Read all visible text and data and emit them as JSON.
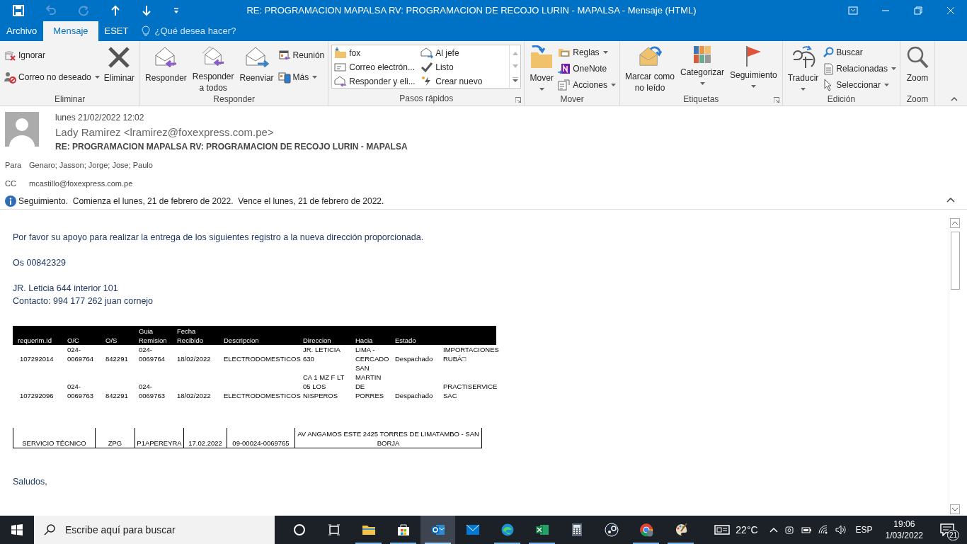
{
  "window": {
    "title": "RE: PROGRAMACION MAPALSA RV: PROGRAMACION DE RECOJO LURIN - MAPALSA - Mensaje (HTML)"
  },
  "tabs": [
    {
      "label": "Archivo",
      "selected": false
    },
    {
      "label": "Mensaje",
      "selected": true
    },
    {
      "label": "ESET",
      "selected": false
    }
  ],
  "tell_me": {
    "placeholder": "¿Qué desea hacer?"
  },
  "ribbon": {
    "groups": [
      {
        "label": "Eliminar",
        "columns": [
          {
            "kind": "stack",
            "items": [
              {
                "label": "Ignorar",
                "dropdown": false
              },
              {
                "label": "Correo no deseado",
                "dropdown": true
              }
            ]
          },
          {
            "kind": "large",
            "label": "Eliminar",
            "dropdown": false
          }
        ]
      },
      {
        "label": "Responder",
        "columns": [
          {
            "kind": "large",
            "label": "Responder",
            "dropdown": false
          },
          {
            "kind": "large",
            "label": "Responder\na todos",
            "dropdown": false
          },
          {
            "kind": "large",
            "label": "Reenviar",
            "dropdown": false
          },
          {
            "kind": "stack",
            "items": [
              {
                "label": "Reunión",
                "dropdown": false
              },
              {
                "label": "Más",
                "dropdown": true
              }
            ]
          }
        ]
      },
      {
        "label": "Pasos rápidos",
        "launcher": true,
        "columns": [
          {
            "kind": "gallery",
            "items": [
              {
                "label": "fox"
              },
              {
                "label": "Al jefe"
              },
              {
                "label": "Correo electrón..."
              },
              {
                "label": "Listo"
              },
              {
                "label": "Responder y eli..."
              },
              {
                "label": "Crear nuevo"
              }
            ]
          }
        ]
      },
      {
        "label": "Mover",
        "columns": [
          {
            "kind": "large",
            "label": "Mover",
            "dropdown": true
          },
          {
            "kind": "stack",
            "items": [
              {
                "label": "Reglas",
                "dropdown": true
              },
              {
                "label": "OneNote",
                "dropdown": false
              },
              {
                "label": "Acciones",
                "dropdown": true
              }
            ]
          }
        ]
      },
      {
        "label": "Etiquetas",
        "launcher": true,
        "columns": [
          {
            "kind": "large",
            "label": "Marcar como\nno leído",
            "dropdown": false
          },
          {
            "kind": "large",
            "label": "Categorizar",
            "dropdown": true
          },
          {
            "kind": "large",
            "label": "Seguimiento",
            "dropdown": true
          }
        ]
      },
      {
        "label": "Edición",
        "columns": [
          {
            "kind": "large",
            "label": "Traducir",
            "dropdown": true
          },
          {
            "kind": "stack",
            "items": [
              {
                "label": "Buscar",
                "dropdown": false
              },
              {
                "label": "Relacionadas",
                "dropdown": true
              },
              {
                "label": "Seleccionar",
                "dropdown": true
              }
            ]
          }
        ]
      },
      {
        "label": "Zoom",
        "columns": [
          {
            "kind": "large",
            "label": "Zoom",
            "dropdown": false
          }
        ]
      }
    ]
  },
  "message": {
    "date": "lunes 21/02/2022 12:02",
    "sender": "Lady Ramirez <lramirez@foxexpress.com.pe>",
    "subject": "RE: PROGRAMACION MAPALSA RV: PROGRAMACION DE RECOJO LURIN - MAPALSA",
    "to_label": "Para",
    "to": "Genaro; Jasson; Jorge; Jose; Paulo",
    "cc_label": "CC",
    "cc": "mcastillo@foxexpress.com.pe",
    "info": "Seguimiento.  Comienza el lunes, 21 de febrero de 2022.  Vence el lunes, 21 de febrero de 2022."
  },
  "body": {
    "intro": "Por favor su apoyo para realizar la entrega de los siguientes registro  a la nueva dirección proporcionada.",
    "order": "Os 00842329",
    "address": [
      "JR. Leticia 644 interior 101",
      "Contacto: 994 177 262 juan cornejo"
    ],
    "table": {
      "columns": [
        "requerim.Id",
        "O/C",
        "O/S",
        "Guia Remision",
        "Fecha Recibido",
        "Descripcion",
        "Direccion",
        "Hacia",
        "Estado",
        ""
      ],
      "rows": [
        [
          "107292014",
          "024-0069764",
          "842291",
          "024-0069764",
          "18/02/2022",
          "ELECTRODOMESTICOS",
          "JR. LETICIA 630",
          "LIMA - CERCADO",
          "Despachado",
          "IMPORTACIONES RUBÃ□"
        ],
        [
          "107292096",
          "024-0069763",
          "842291",
          "024-0069763",
          "18/02/2022",
          "ELECTRODOMESTICOS",
          "CA 1 MZ F LT 05 LOS NISPEROS",
          "SAN MARTIN DE PORRES",
          "Despachado",
          "PRACTISERVICE SAC"
        ]
      ]
    },
    "table_2": {
      "cells": [
        "SERVICIO TÉCNICO",
        "ZPG",
        "P1APEREYRA",
        "17.02.2022",
        "09-00024-0069765",
        "AV ANGAMOS ESTE 2425 TORRES DE LIMATAMBO - SAN BORJA"
      ]
    },
    "closing": "Saludos,"
  },
  "taskbar": {
    "search_placeholder": "Escribe aquí para buscar",
    "apps": [
      {
        "active": false
      },
      {
        "active": false
      },
      {
        "active": true
      },
      {
        "active": false
      },
      {
        "active": false
      },
      {
        "active": false
      },
      {
        "active": false
      },
      {
        "active": false
      },
      {
        "active": false
      },
      {
        "active": false
      }
    ],
    "temperature": "22°C",
    "language": "ESP",
    "time": "19:06",
    "date": "1/03/2022",
    "notifications": "21"
  }
}
